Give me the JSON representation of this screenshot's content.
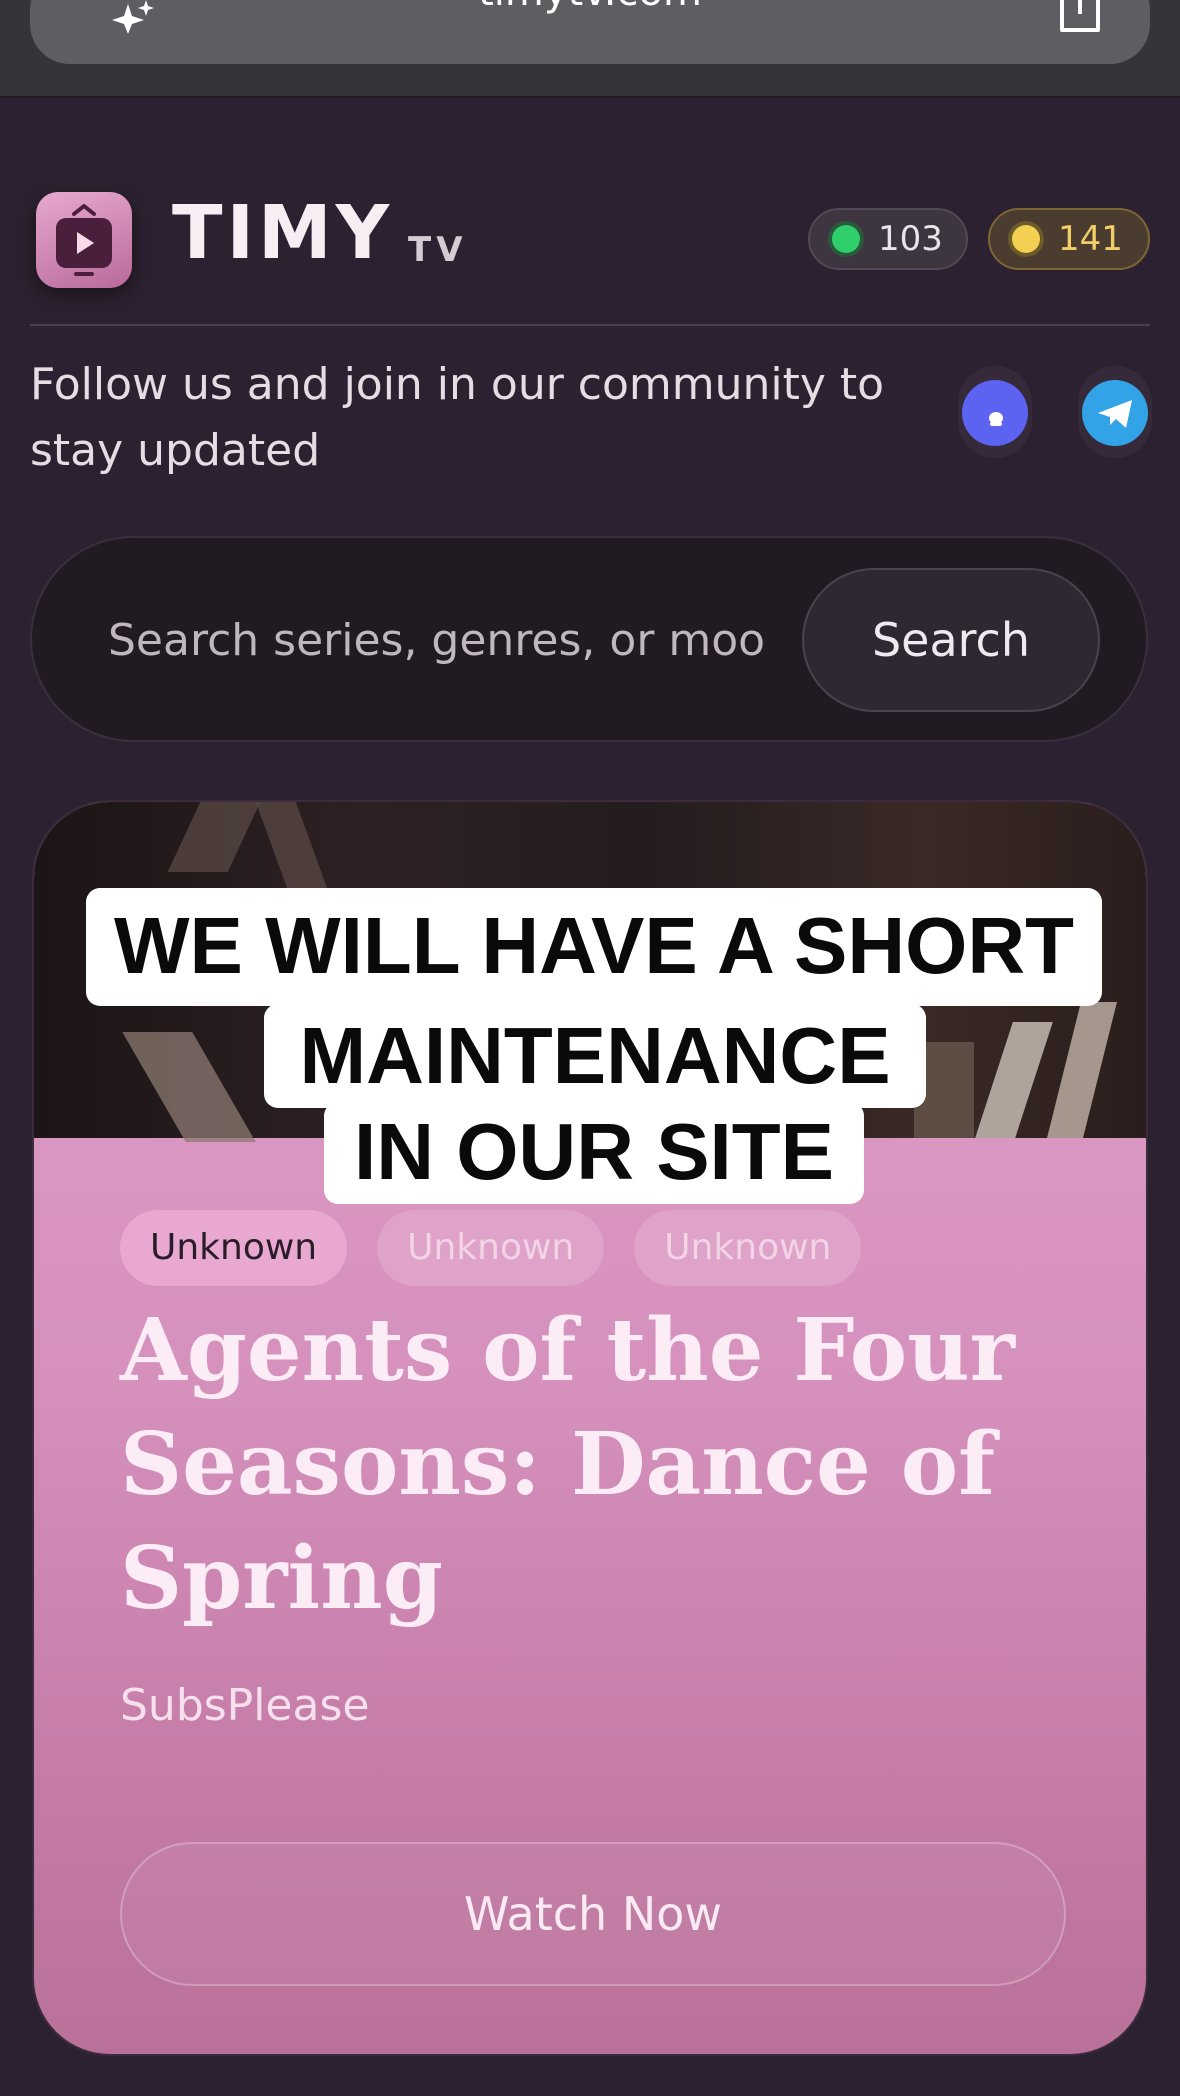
{
  "browser": {
    "url": "timytv.com",
    "left_icon": "sparkle-icon",
    "right_icon": "share-icon"
  },
  "header": {
    "logo_icon": "tv-play-icon",
    "logo_word": "TIMY",
    "logo_sub": "TV",
    "stats": [
      {
        "value": "103",
        "color": "#2fcf6b"
      },
      {
        "value": "141",
        "color": "#f3cf52"
      }
    ]
  },
  "community": {
    "text": "Follow us and join in our community to stay updated",
    "links": [
      {
        "icon": "discord-icon",
        "color": "#5b63f0"
      },
      {
        "icon": "telegram-icon",
        "color": "#33a3e8"
      }
    ]
  },
  "search": {
    "placeholder": "Search series, genres, or moo",
    "button_label": "Search"
  },
  "banner": {
    "lines": [
      "WE WILL HAVE A SHORT",
      "MAINTENANCE",
      "IN OUR SITE"
    ]
  },
  "featured": {
    "tags": [
      "Unknown",
      "Unknown",
      "Unknown"
    ],
    "title": "Agents of the Four Seasons: Dance of Spring",
    "source": "SubsPlease",
    "watch_label": "Watch Now"
  }
}
